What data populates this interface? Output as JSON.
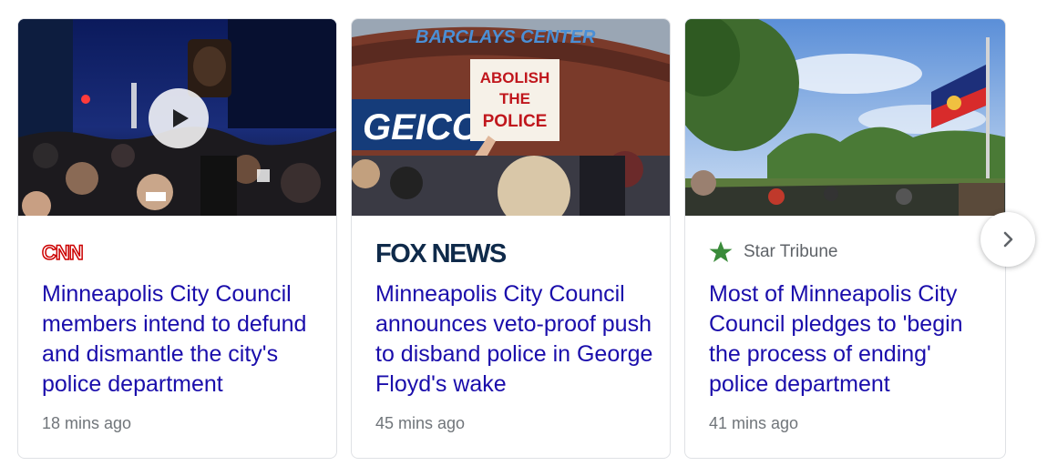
{
  "cards": [
    {
      "source": "CNN",
      "source_logo": "cnn-logo",
      "headline": "Minneapolis City Council members intend to defund and dismantle the city's police department",
      "time": "18 mins ago",
      "has_video": true,
      "image_sign": ""
    },
    {
      "source": "FOX NEWS",
      "source_logo": "fox-news-logo",
      "headline": "Minneapolis City Council announces veto-proof push to disband police in George Floyd's wake",
      "time": "45 mins ago",
      "has_video": false,
      "image_sign": "ABOLISH THE POLICE",
      "image_arena_sign": "BARCLAYS CENTER",
      "image_ad": "GEICO"
    },
    {
      "source": "Star Tribune",
      "source_logo": "star-icon",
      "headline": "Most of Minneapolis City Council pledges to 'begin the process of ending' police department",
      "time": "41 mins ago",
      "has_video": false,
      "image_sign": ""
    }
  ],
  "next_button": {
    "icon": "chevron-right-icon"
  },
  "colors": {
    "headline": "#1a0dab",
    "meta": "#70757a",
    "cnn_red": "#cc0000",
    "fox_navy": "#0f2a4a",
    "star_green": "#3a8b3a"
  }
}
